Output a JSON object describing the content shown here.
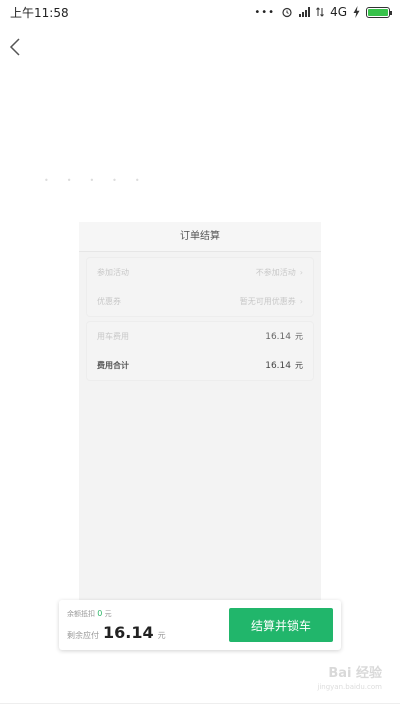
{
  "status_bar": {
    "time": "上午11:58",
    "dots": "•••",
    "network": "4G"
  },
  "order": {
    "title": "订单结算",
    "promo_section": [
      {
        "label": "参加活动",
        "value": "不参加活动"
      },
      {
        "label": "优惠券",
        "value": "暂无可用优惠券"
      }
    ],
    "fee_section": [
      {
        "label": "用车费用",
        "amount": "16.14",
        "unit": "元"
      },
      {
        "label": "费用合计",
        "amount": "16.14",
        "unit": "元"
      }
    ]
  },
  "pay_bar": {
    "balance_label": "余额抵扣",
    "balance_value": "0",
    "balance_unit": "元",
    "due_label": "剩余应付",
    "due_amount": "16.14",
    "due_unit": "元",
    "button_label": "结算并锁车"
  },
  "watermark": {
    "brand": "Bai 经验",
    "sub": "jingyan.baidu.com"
  },
  "colors": {
    "accent_green": "#21b66b",
    "battery_green": "#37c24a"
  }
}
